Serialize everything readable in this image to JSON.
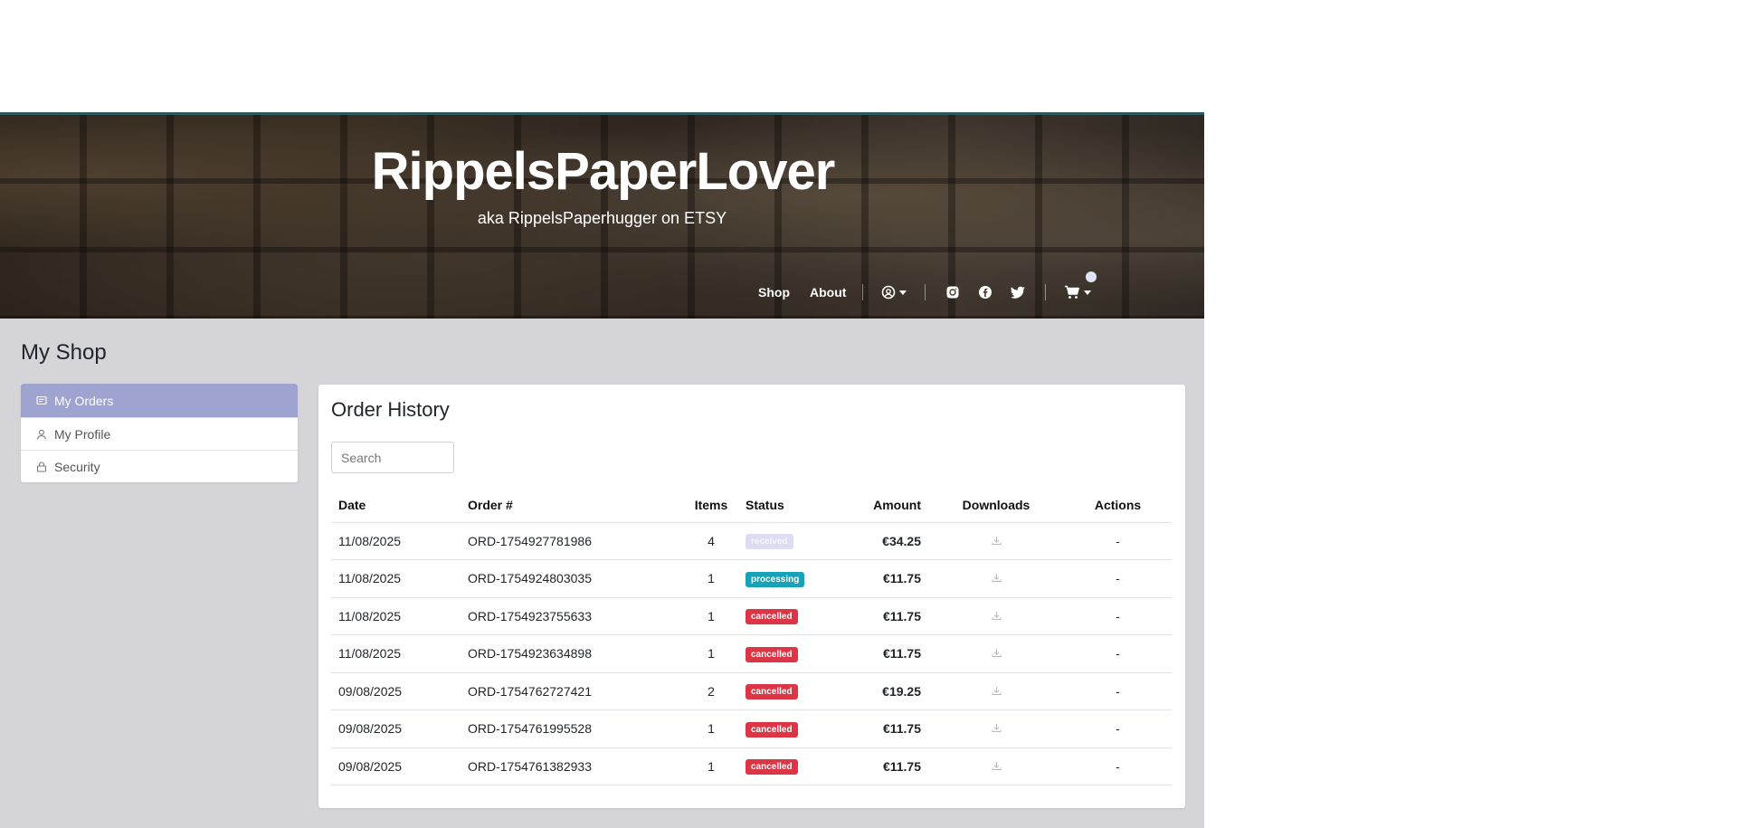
{
  "hero": {
    "title": "RippelsPaperLover",
    "subtitle": "aka RippelsPaperhugger on ETSY"
  },
  "nav": {
    "shop": "Shop",
    "about": "About"
  },
  "page": {
    "title": "My Shop"
  },
  "sidebar": {
    "items": [
      {
        "label": "My Orders",
        "icon": "message-square-icon",
        "active": true
      },
      {
        "label": "My Profile",
        "icon": "user-icon",
        "active": false
      },
      {
        "label": "Security",
        "icon": "lock-icon",
        "active": false
      }
    ]
  },
  "orders": {
    "title": "Order History",
    "search_placeholder": "Search",
    "columns": [
      "Date",
      "Order #",
      "Items",
      "Status",
      "Amount",
      "Downloads",
      "Actions"
    ],
    "rows": [
      {
        "date": "11/08/2025",
        "order": "ORD-1754927781986",
        "items": "4",
        "status": "received",
        "amount": "€34.25",
        "action": "-"
      },
      {
        "date": "11/08/2025",
        "order": "ORD-1754924803035",
        "items": "1",
        "status": "processing",
        "amount": "€11.75",
        "action": "-"
      },
      {
        "date": "11/08/2025",
        "order": "ORD-1754923755633",
        "items": "1",
        "status": "cancelled",
        "amount": "€11.75",
        "action": "-"
      },
      {
        "date": "11/08/2025",
        "order": "ORD-1754923634898",
        "items": "1",
        "status": "cancelled",
        "amount": "€11.75",
        "action": "-"
      },
      {
        "date": "09/08/2025",
        "order": "ORD-1754762727421",
        "items": "2",
        "status": "cancelled",
        "amount": "€19.25",
        "action": "-"
      },
      {
        "date": "09/08/2025",
        "order": "ORD-1754761995528",
        "items": "1",
        "status": "cancelled",
        "amount": "€11.75",
        "action": "-"
      },
      {
        "date": "09/08/2025",
        "order": "ORD-1754761382933",
        "items": "1",
        "status": "cancelled",
        "amount": "€11.75",
        "action": "-"
      }
    ]
  },
  "colors": {
    "accent": "#9fa3d0",
    "processing": "#17a2b8",
    "cancelled": "#dc3545",
    "received": "#dcdcf3",
    "background": "#d4d4d9"
  }
}
